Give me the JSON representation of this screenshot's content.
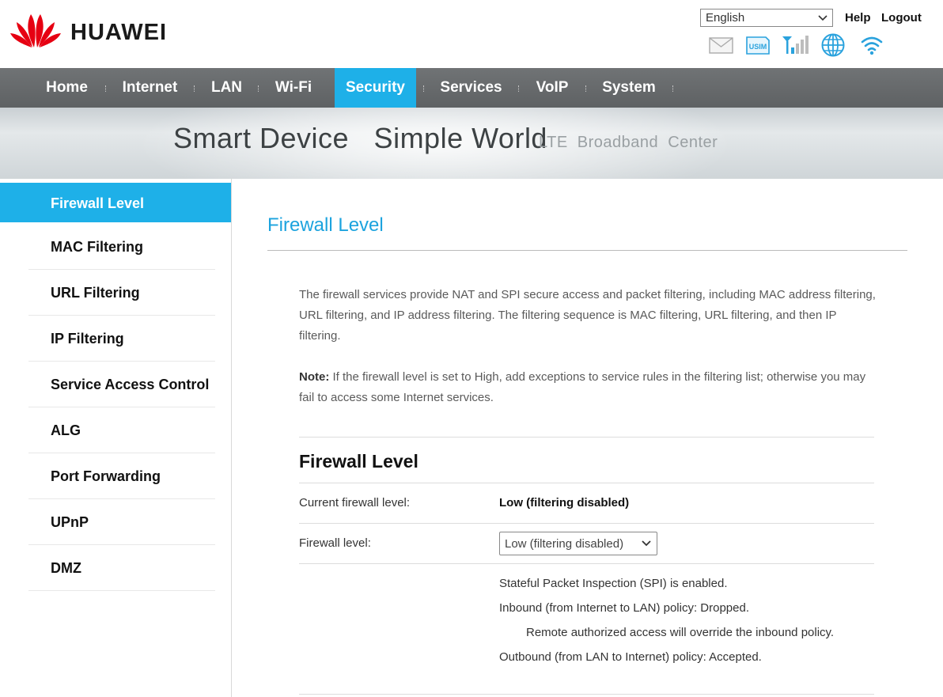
{
  "header": {
    "brand": "HUAWEI",
    "language": "English",
    "help": "Help",
    "logout": "Logout",
    "status_icons": [
      "mail-icon",
      "usim-icon",
      "signal-icon",
      "globe-icon",
      "wifi-icon"
    ],
    "usim_text": "USIM"
  },
  "nav": {
    "items": [
      {
        "label": "Home"
      },
      {
        "label": "Internet"
      },
      {
        "label": "LAN"
      },
      {
        "label": "Wi-Fi"
      },
      {
        "label": "Security",
        "active": true
      },
      {
        "label": "Services"
      },
      {
        "label": "VoIP"
      },
      {
        "label": "System"
      }
    ]
  },
  "banner": {
    "slogan": "Smart Device   Simple World",
    "subtitle": "LTE  Broadband  Center"
  },
  "sidebar": {
    "items": [
      {
        "label": "Firewall Level",
        "active": true
      },
      {
        "label": "MAC Filtering"
      },
      {
        "label": "URL Filtering"
      },
      {
        "label": "IP Filtering"
      },
      {
        "label": "Service Access Control"
      },
      {
        "label": "ALG"
      },
      {
        "label": "Port Forwarding"
      },
      {
        "label": "UPnP"
      },
      {
        "label": "DMZ"
      }
    ]
  },
  "main": {
    "page_title": "Firewall Level",
    "description": "The firewall services provide NAT and SPI secure access and packet filtering, including MAC address filtering, URL filtering, and IP address filtering. The filtering sequence is MAC filtering, URL filtering, and then IP filtering.",
    "note_label": "Note:",
    "note_text": " If the firewall level is set to High, add exceptions to service rules in the filtering list; otherwise you may fail to access some Internet services.",
    "section_title": "Firewall Level",
    "current_level_label": "Current firewall level:",
    "current_level_value": "Low (filtering disabled)",
    "level_label": "Firewall level:",
    "level_select_value": "Low (filtering disabled)",
    "info_lines": {
      "spi": "Stateful Packet Inspection (SPI) is enabled.",
      "inbound": "Inbound (from Internet to LAN) policy: Dropped.",
      "remote": "Remote authorized access will override the inbound policy.",
      "outbound": "Outbound (from LAN to Internet) policy: Accepted."
    }
  },
  "colors": {
    "accent": "#1eb0e8",
    "nav_bg": "#6b6e70",
    "brand_red": "#e60012"
  }
}
